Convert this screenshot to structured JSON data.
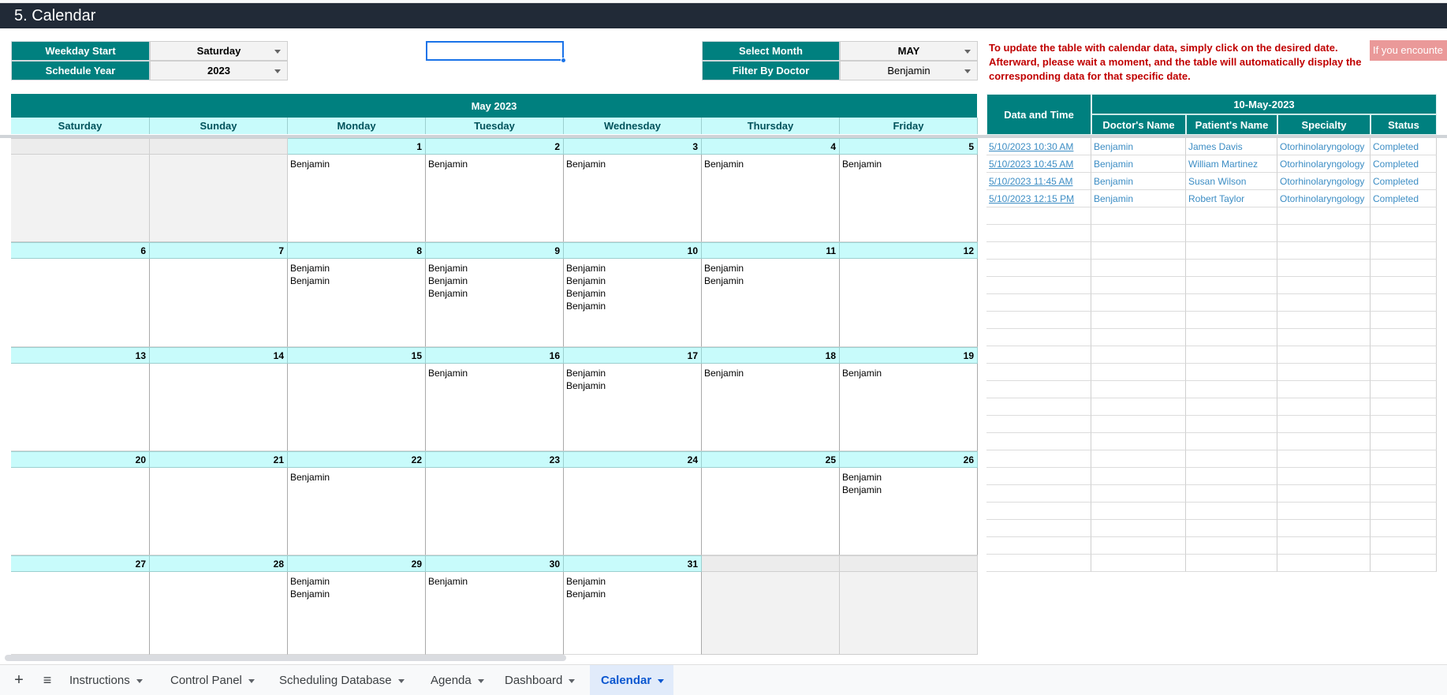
{
  "title": "5. Calendar",
  "controls": {
    "weekday_start_label": "Weekday Start",
    "weekday_start_value": "Saturday",
    "schedule_year_label": "Schedule Year",
    "schedule_year_value": "2023",
    "select_month_label": "Select Month",
    "select_month_value": "MAY",
    "filter_doctor_label": "Filter By Doctor",
    "filter_doctor_value": "Benjamin"
  },
  "note": "To update the table with calendar data, simply click on the desired date. Afterward, please wait a moment, and the table will automatically display the corresponding data for that specific date.",
  "alert_text": "If you encounte",
  "calendar": {
    "title": "May 2023",
    "weekdays": [
      "Saturday",
      "Sunday",
      "Monday",
      "Tuesday",
      "Wednesday",
      "Thursday",
      "Friday"
    ],
    "weeks": [
      [
        {
          "day": "",
          "entries": []
        },
        {
          "day": "",
          "entries": []
        },
        {
          "day": "1",
          "entries": [
            "Benjamin"
          ]
        },
        {
          "day": "2",
          "entries": [
            "Benjamin"
          ]
        },
        {
          "day": "3",
          "entries": [
            "Benjamin"
          ]
        },
        {
          "day": "4",
          "entries": [
            "Benjamin"
          ]
        },
        {
          "day": "5",
          "entries": [
            "Benjamin"
          ]
        }
      ],
      [
        {
          "day": "6",
          "entries": []
        },
        {
          "day": "7",
          "entries": []
        },
        {
          "day": "8",
          "entries": [
            "Benjamin",
            "Benjamin"
          ]
        },
        {
          "day": "9",
          "entries": [
            "Benjamin",
            "Benjamin",
            "Benjamin"
          ]
        },
        {
          "day": "10",
          "entries": [
            "Benjamin",
            "Benjamin",
            "Benjamin",
            "Benjamin"
          ]
        },
        {
          "day": "11",
          "entries": [
            "Benjamin",
            "Benjamin"
          ]
        },
        {
          "day": "12",
          "entries": []
        }
      ],
      [
        {
          "day": "13",
          "entries": []
        },
        {
          "day": "14",
          "entries": []
        },
        {
          "day": "15",
          "entries": []
        },
        {
          "day": "16",
          "entries": [
            "Benjamin"
          ]
        },
        {
          "day": "17",
          "entries": [
            "Benjamin",
            "Benjamin"
          ]
        },
        {
          "day": "18",
          "entries": [
            "Benjamin"
          ]
        },
        {
          "day": "19",
          "entries": [
            "Benjamin"
          ]
        }
      ],
      [
        {
          "day": "20",
          "entries": []
        },
        {
          "day": "21",
          "entries": []
        },
        {
          "day": "22",
          "entries": [
            "Benjamin"
          ]
        },
        {
          "day": "23",
          "entries": []
        },
        {
          "day": "24",
          "entries": []
        },
        {
          "day": "25",
          "entries": []
        },
        {
          "day": "26",
          "entries": [
            "Benjamin",
            "Benjamin"
          ]
        }
      ],
      [
        {
          "day": "27",
          "entries": []
        },
        {
          "day": "28",
          "entries": []
        },
        {
          "day": "29",
          "entries": [
            "Benjamin",
            "Benjamin"
          ]
        },
        {
          "day": "30",
          "entries": [
            "Benjamin"
          ]
        },
        {
          "day": "31",
          "entries": [
            "Benjamin",
            "Benjamin"
          ]
        },
        {
          "day": "",
          "entries": []
        },
        {
          "day": "",
          "entries": []
        }
      ]
    ]
  },
  "detail": {
    "date_time_header": "Data and Time",
    "date_header": "10-May-2023",
    "columns": [
      "Doctor's Name",
      "Patient's Name",
      "Specialty",
      "Status"
    ],
    "rows": [
      [
        "5/10/2023 10:30 AM",
        "Benjamin",
        "James Davis",
        "Otorhinolaryngology",
        "Completed"
      ],
      [
        "5/10/2023 10:45 AM",
        "Benjamin",
        "William Martinez",
        "Otorhinolaryngology",
        "Completed"
      ],
      [
        "5/10/2023 11:45 AM",
        "Benjamin",
        "Susan Wilson",
        "Otorhinolaryngology",
        "Completed"
      ],
      [
        "5/10/2023 12:15 PM",
        "Benjamin",
        "Robert Taylor",
        "Otorhinolaryngology",
        "Completed"
      ]
    ]
  },
  "sheet_tabs": [
    {
      "label": "Instructions",
      "active": false
    },
    {
      "label": "Control Panel",
      "active": false
    },
    {
      "label": "Scheduling Database",
      "active": false
    },
    {
      "label": "Agenda",
      "active": false
    },
    {
      "label": "Dashboard",
      "active": false
    },
    {
      "label": "Calendar",
      "active": true
    }
  ],
  "tabbar_icons": {
    "add": "add-sheet-icon",
    "list": "all-sheets-icon"
  }
}
